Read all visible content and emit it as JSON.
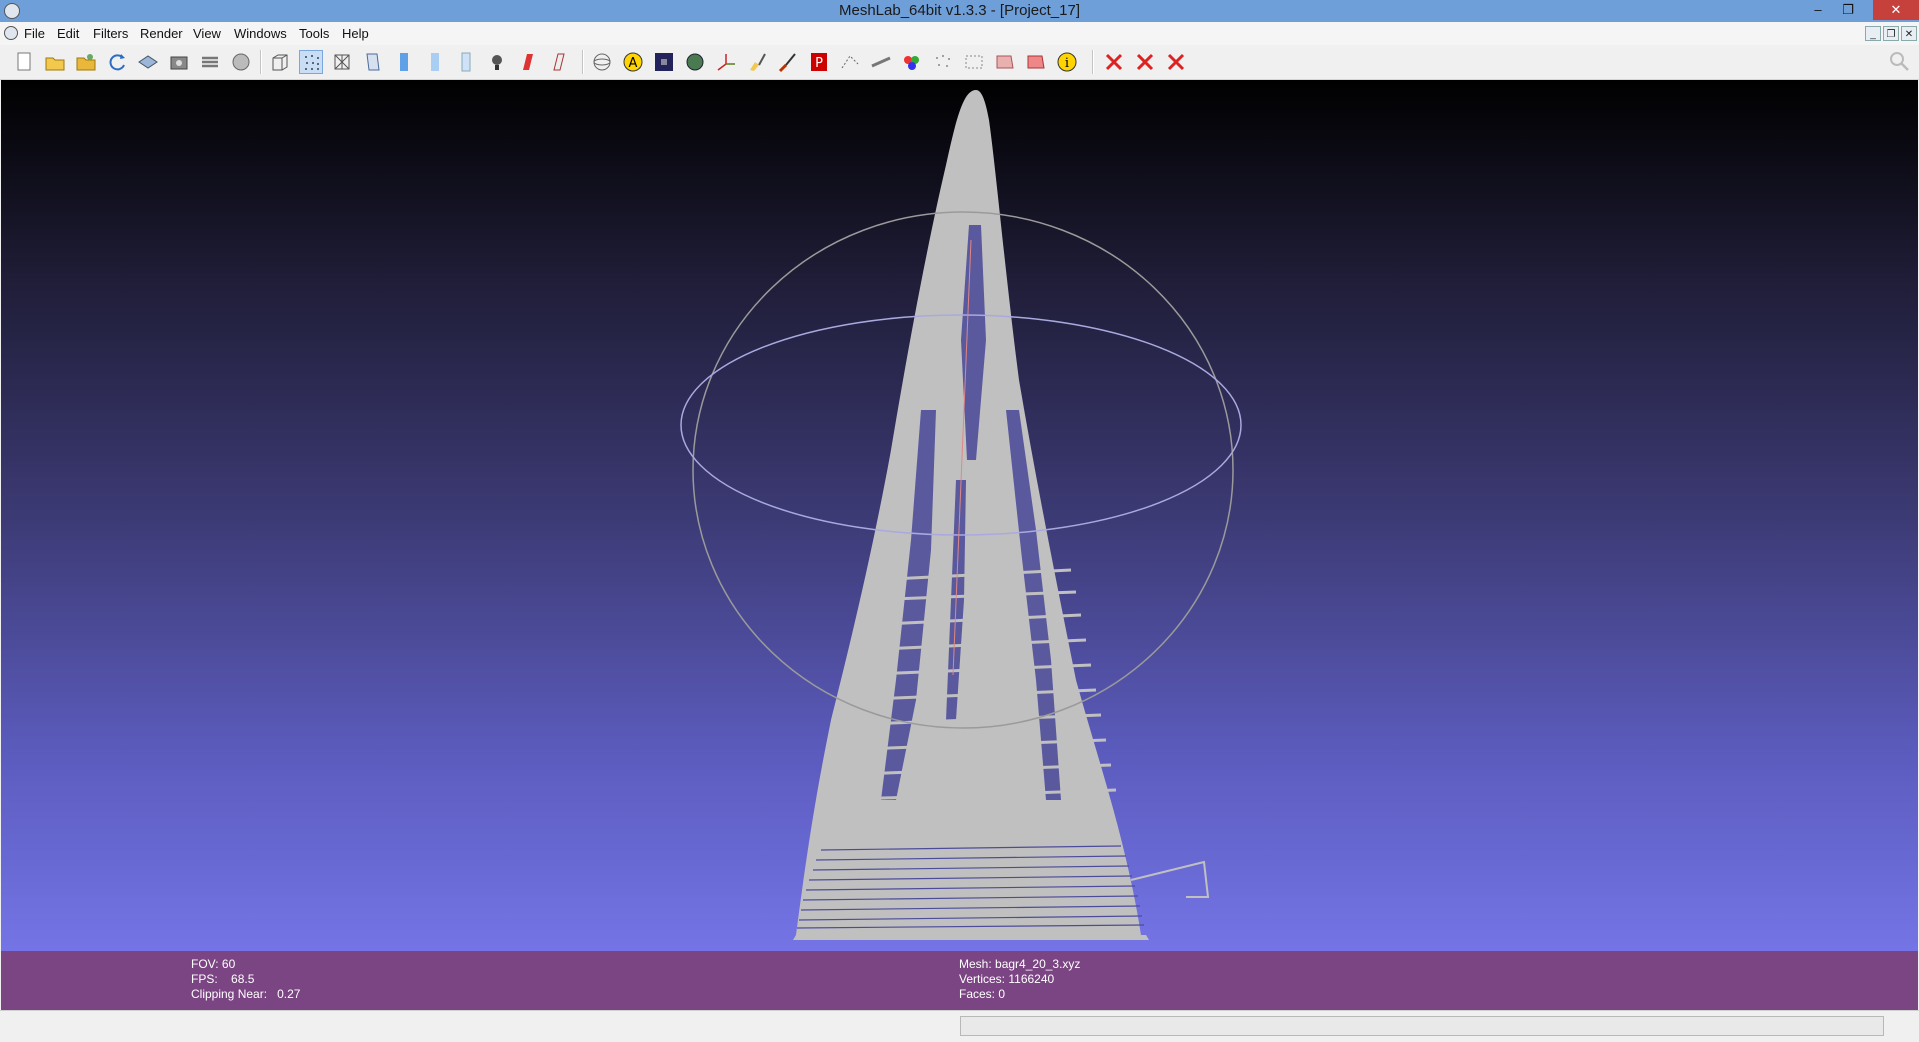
{
  "window": {
    "title": "MeshLab_64bit v1.3.3 - [Project_17]",
    "controls": {
      "minimize": "–",
      "restore": "❐",
      "close": "✕"
    }
  },
  "menubar": {
    "items": [
      "File",
      "Edit",
      "Filters",
      "Render",
      "View",
      "Windows",
      "Tools",
      "Help"
    ]
  },
  "mdi_controls": {
    "minimize": "_",
    "restore": "❐",
    "close": "✕"
  },
  "toolbar": {
    "icons": [
      "new-project-icon",
      "open-project-icon",
      "open-mesh-icon",
      "reload-icon",
      "save-icon",
      "snapshot-icon",
      "layers-icon",
      "flat-render-icon",
      "bounding-box-icon",
      "points-render-icon",
      "wireframe-icon",
      "hidden-lines-icon",
      "flat-shading-icon",
      "smooth-shading-icon",
      "texture-icon",
      "light-icon",
      "color-per-vertex-icon",
      "fancy-lighting-icon",
      "trackball-icon",
      "annotation-icon",
      "dark-box-icon",
      "sphere-icon",
      "axis-icon",
      "paint-brush-icon",
      "brush-icon",
      "pick-points-icon",
      "select-vertices-icon",
      "measure-icon",
      "color-tool-icon",
      "align-icon",
      "reference-icon",
      "select-faces-icon",
      "delete-faces-icon",
      "info-icon",
      "delete-selected-icon",
      "delete-vertices-icon",
      "delete-faces-red-icon"
    ],
    "active_icon": "points-render-icon"
  },
  "scene": {
    "mesh_color": "#c0c0c0",
    "trackball_color": "#9a9a9a",
    "equator_color": "#a9a9e0"
  },
  "info": {
    "fov_label": "FOV:",
    "fov_value": "60",
    "fps_label": "FPS:",
    "fps_value": "68.5",
    "clipping_label": "Clipping Near:",
    "clipping_value": "0.27",
    "mesh_label": "Mesh:",
    "mesh_value": "bagr4_20_3.xyz",
    "vertices_label": "Vertices:",
    "vertices_value": "1166240",
    "faces_label": "Faces:",
    "faces_value": "0"
  },
  "status": {
    "progress_percent": 0
  }
}
